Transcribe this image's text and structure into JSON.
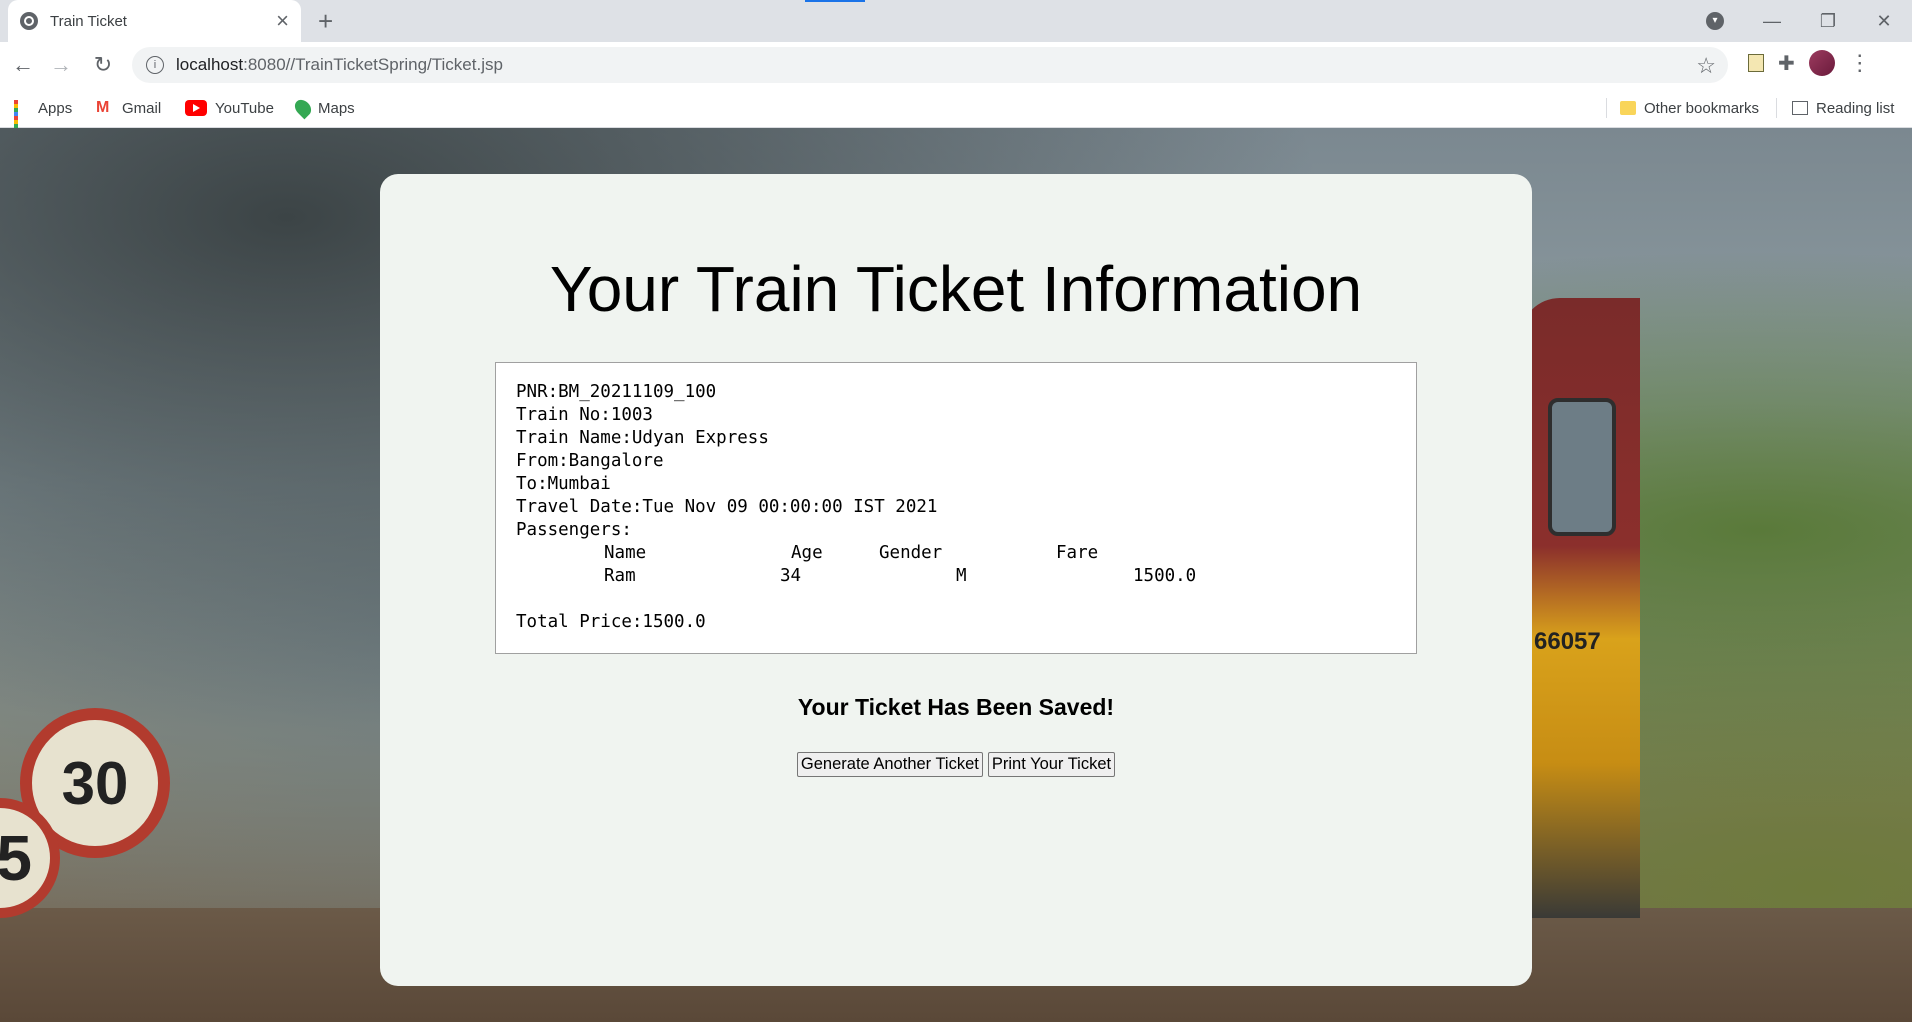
{
  "browser": {
    "tab_title": "Train Ticket",
    "url_host": "localhost",
    "url_path": ":8080//TrainTicketSpring/Ticket.jsp",
    "bookmarks": [
      {
        "label": "Apps"
      },
      {
        "label": "Gmail"
      },
      {
        "label": "YouTube"
      },
      {
        "label": "Maps"
      }
    ],
    "other_bookmarks": "Other bookmarks",
    "reading_list": "Reading list"
  },
  "page": {
    "heading": "Your Train Ticket Information",
    "ticket": {
      "pnr": "PNR:BM_20211109_100",
      "train_no": "Train No:1003",
      "train_name": "Train Name:Udyan Express",
      "from": "From:Bangalore",
      "to": "To:Mumbai",
      "travel_date": "Travel Date:Tue Nov 09 00:00:00 IST 2021",
      "passengers_label": "Passengers:",
      "columns": {
        "name": "Name",
        "age": "Age",
        "gender": "Gender",
        "fare": "Fare"
      },
      "passengers": [
        {
          "name": "Ram",
          "age": "34",
          "gender": "M",
          "fare": "1500.0"
        }
      ],
      "total_price": "Total Price:1500.0"
    },
    "saved_message": "Your Ticket Has Been Saved!",
    "buttons": {
      "generate": "Generate Another Ticket",
      "print": "Print Your Ticket"
    }
  },
  "background": {
    "sign_speed": "30",
    "sign_speed_2": "5",
    "train_number": "66057"
  }
}
